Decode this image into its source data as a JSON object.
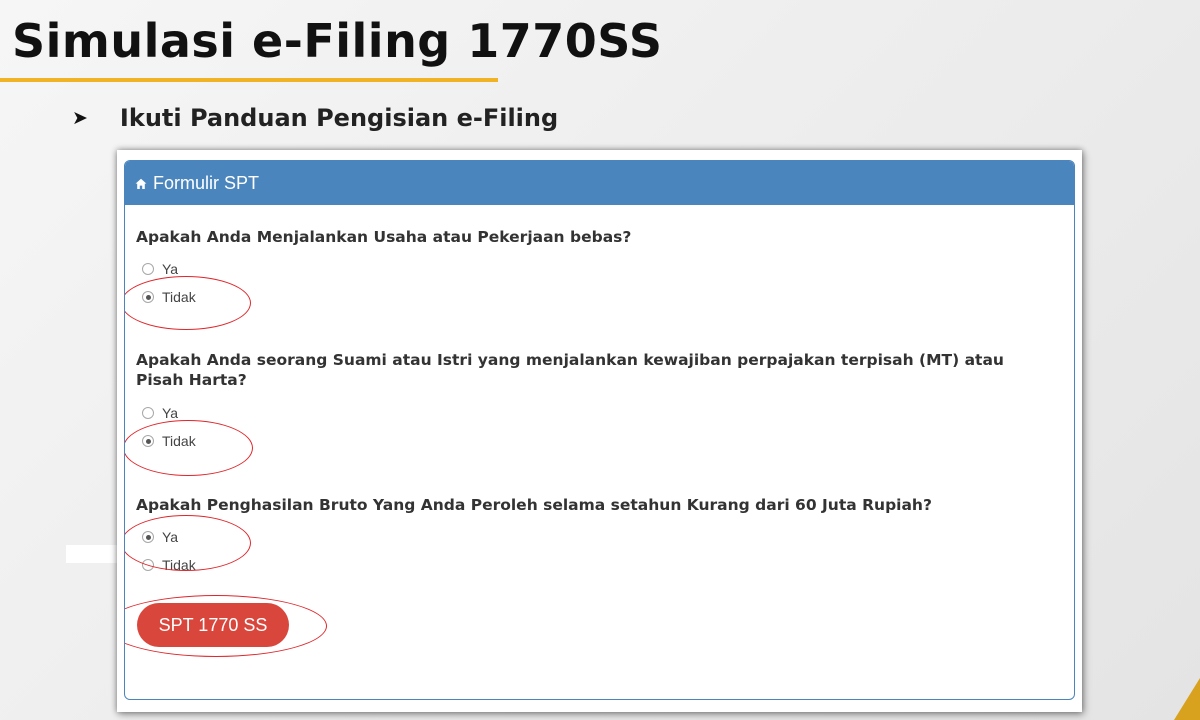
{
  "slide": {
    "title": "Simulasi e-Filing 1770SS",
    "subtitle": "Ikuti Panduan Pengisian e-Filing",
    "accent_color": "#f0b323"
  },
  "panel": {
    "heading": "Formulir SPT",
    "heading_icon": "home-icon",
    "heading_color": "#4a86bd"
  },
  "questions": [
    {
      "text": "Apakah Anda Menjalankan Usaha atau Pekerjaan bebas?",
      "options": [
        {
          "label": "Ya",
          "checked": false
        },
        {
          "label": "Tidak",
          "checked": true
        }
      ]
    },
    {
      "text": "Apakah Anda seorang Suami atau Istri yang menjalankan kewajiban perpajakan terpisah (MT) atau Pisah Harta?",
      "options": [
        {
          "label": "Ya",
          "checked": false
        },
        {
          "label": "Tidak",
          "checked": true
        }
      ]
    },
    {
      "text": "Apakah Penghasilan Bruto Yang Anda Peroleh selama setahun Kurang dari 60 Juta Rupiah?",
      "options": [
        {
          "label": "Ya",
          "checked": true
        },
        {
          "label": "Tidak",
          "checked": false
        }
      ]
    }
  ],
  "submit_button": {
    "label": "SPT 1770 SS",
    "color": "#d9463c"
  },
  "annotation_color": "#e0262a"
}
